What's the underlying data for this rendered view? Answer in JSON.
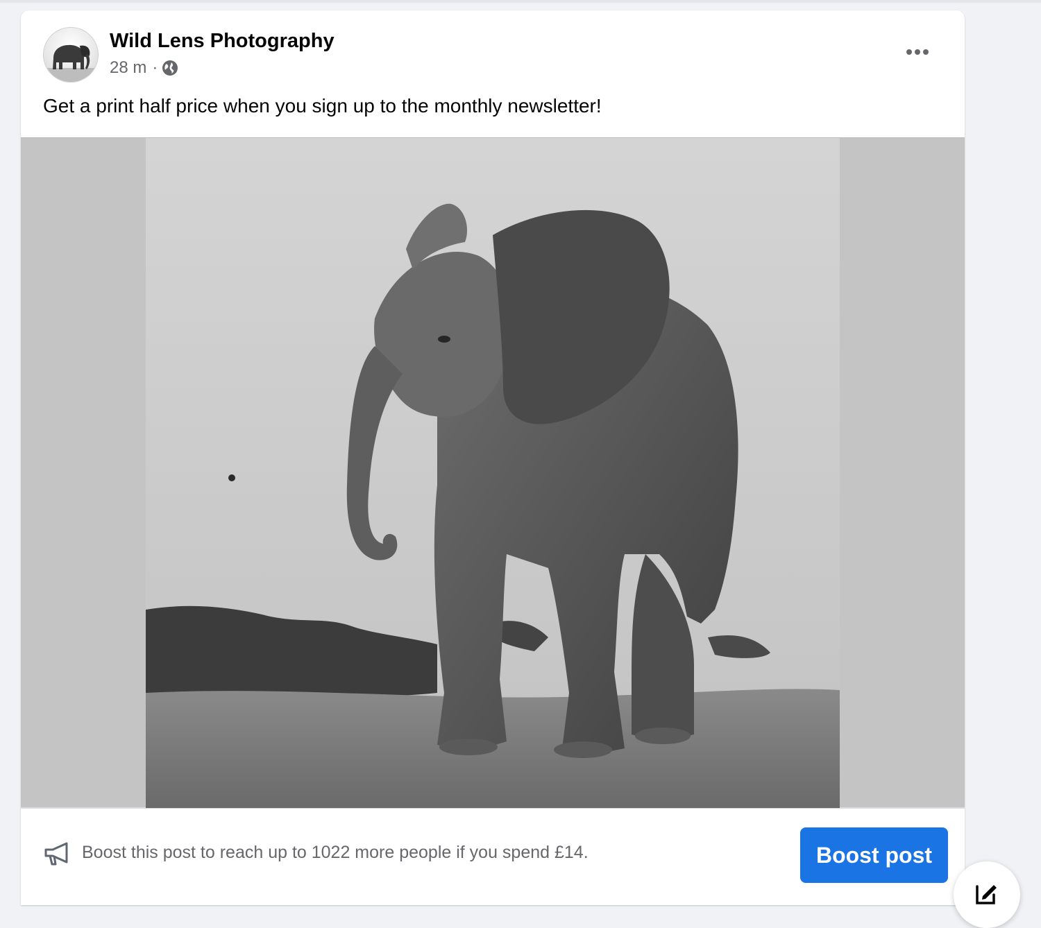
{
  "post": {
    "author": "Wild Lens Photography",
    "time": "28 m",
    "separator": "·",
    "audience_icon": "globe-icon",
    "menu_icon": "more-horizontal-icon",
    "text": "Get a print half price when you sign up to the monthly newsletter!"
  },
  "footer": {
    "boost_icon": "megaphone-icon",
    "boost_prompt": "Boost this post to reach up to 1022 more people if you spend £14.",
    "boost_button": "Boost post"
  },
  "floating": {
    "compose_icon": "compose-icon"
  },
  "colors": {
    "accent": "#1b74e4",
    "secondary_text": "#65676b",
    "primary_text": "#050505",
    "page_background": "#f0f2f5"
  }
}
